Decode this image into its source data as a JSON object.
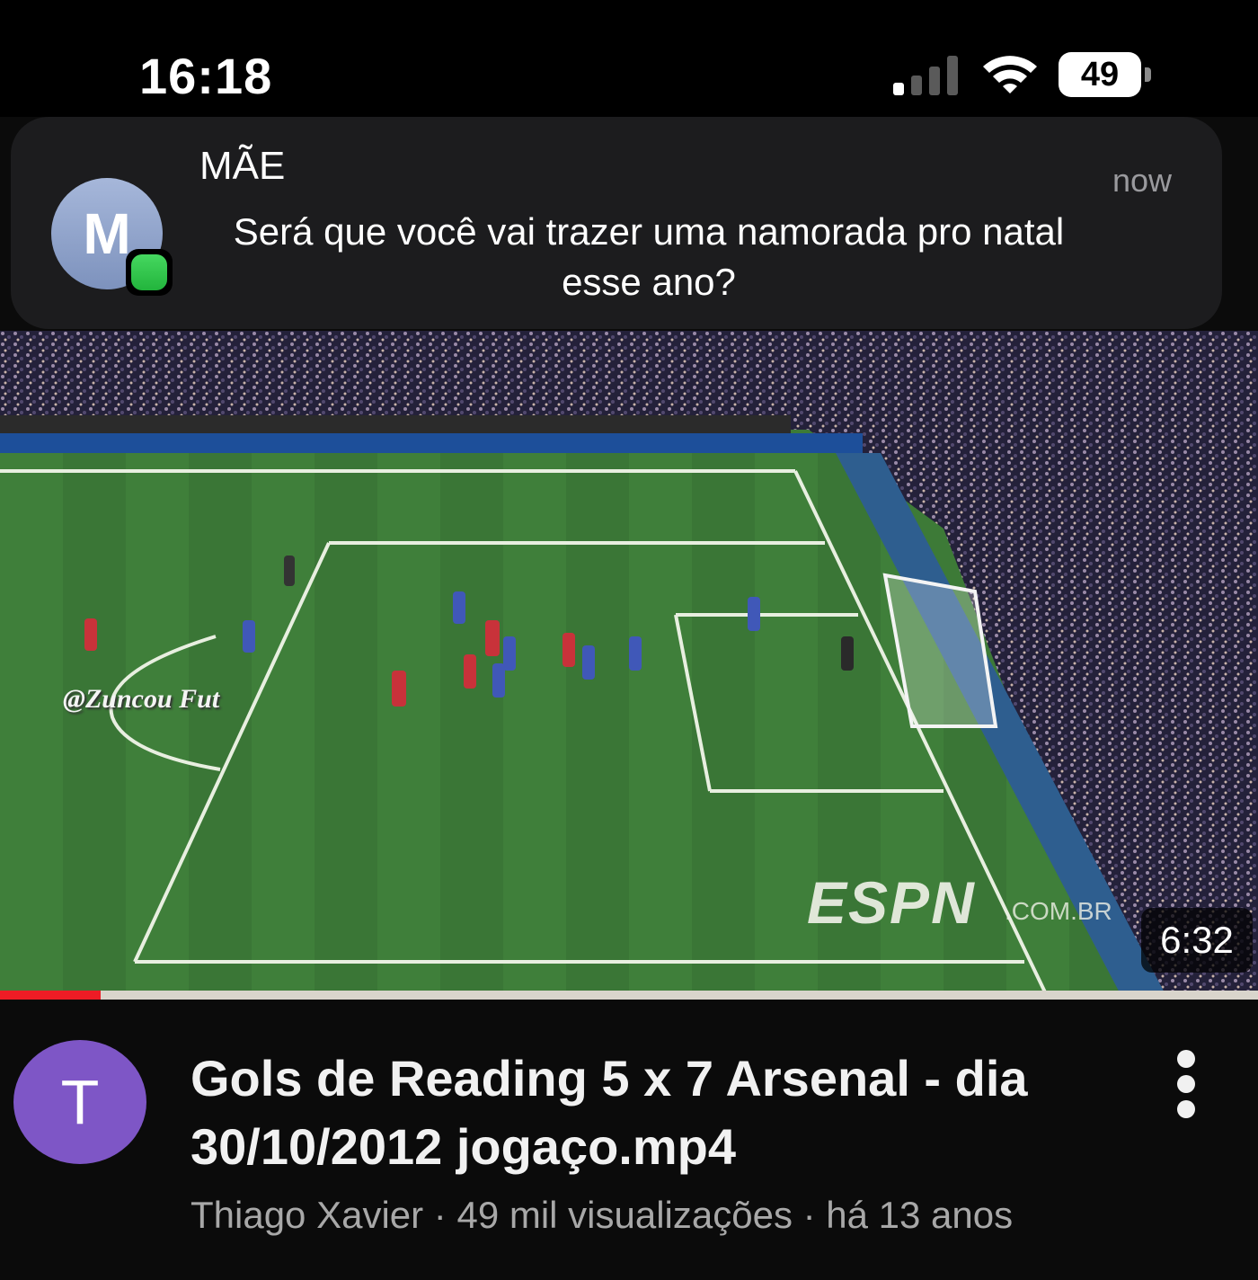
{
  "status_bar": {
    "time": "16:18",
    "battery": "49",
    "icons": [
      "signal-icon",
      "wifi-icon",
      "battery-icon"
    ]
  },
  "notification": {
    "avatar_letter": "M",
    "sender": "MÃE",
    "time": "now",
    "message": "Será que você vai trazer uma namorada pro natal esse ano?",
    "app_badge_color": "#34c759"
  },
  "video": {
    "watermark": "@Zuncou Fut",
    "broadcaster_logo": "ESPN",
    "broadcaster_domain": ".COM.BR",
    "duration": "6:32",
    "progress": 0.08,
    "progress_color": "#ee1c25",
    "channel_avatar_letter": "T",
    "channel_avatar_color": "#7e56c6",
    "title": "Gols de Reading 5 x 7 Arsenal - dia 30/10/2012 jogaço.mp4",
    "meta": "Thiago Xavier · 49 mil visualizações · há 13 anos"
  }
}
